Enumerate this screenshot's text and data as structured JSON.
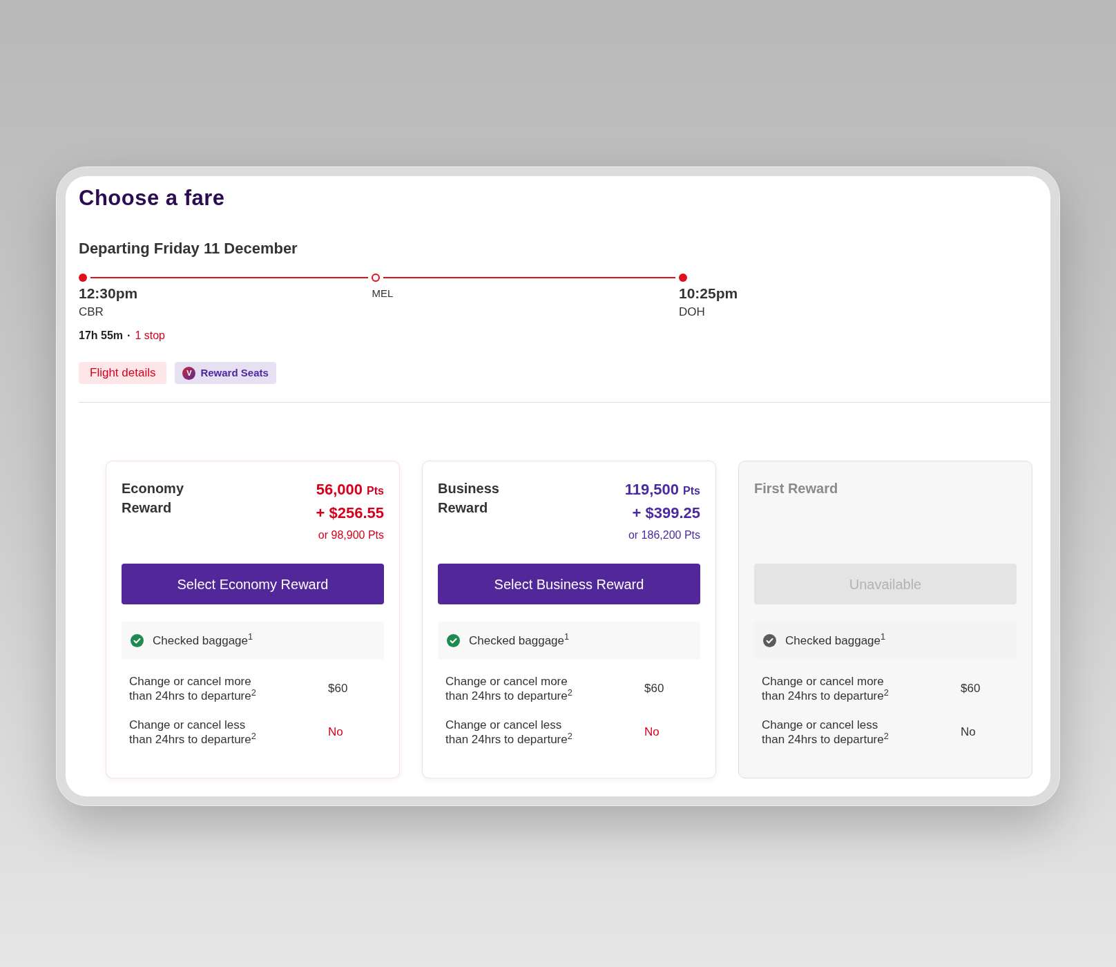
{
  "page": {
    "title": "Choose a fare"
  },
  "journey": {
    "heading": "Departing Friday 11 December",
    "departure": {
      "time": "12:30pm",
      "airport": "CBR"
    },
    "stopovers": [
      {
        "airport": "MEL"
      }
    ],
    "arrival": {
      "time": "10:25pm",
      "airport": "DOH"
    },
    "duration": "17h 55m",
    "separator": "·",
    "stops": "1 stop"
  },
  "actions": [
    {
      "kind": "link",
      "label": "Flight details"
    },
    {
      "kind": "badge",
      "label": "Reward Seats",
      "logo_text": "V"
    }
  ],
  "fares": [
    {
      "name": "Economy Reward",
      "available": true,
      "color": "#d6001c",
      "price": {
        "points": "56,000",
        "points_unit": "Pts",
        "cash": "+ $256.55",
        "alternative": "or 98,900 Pts"
      },
      "button": "Select Economy Reward",
      "features": [
        {
          "kind": "inclusion",
          "label": "Checked baggage$^{1}$",
          "included": true
        },
        {
          "kind": "condition",
          "label": "Change or cancel more than 24hrs to departure$^{2}$",
          "value": "$60",
          "negative": false
        },
        {
          "kind": "condition",
          "label": "Change or cancel less than 24hrs to departure$^{2}$",
          "value": "No",
          "negative": true
        }
      ]
    },
    {
      "name": "Business Reward",
      "available": true,
      "color": "#4b2a9e",
      "price": {
        "points": "119,500",
        "points_unit": "Pts",
        "cash": "+ $399.25",
        "alternative": "or 186,200 Pts"
      },
      "button": "Select Business Reward",
      "features": [
        {
          "kind": "inclusion",
          "label": "Checked baggage$^{1}$",
          "included": true
        },
        {
          "kind": "condition",
          "label": "Change or cancel more than 24hrs to departure$^{2}$",
          "value": "$60",
          "negative": false
        },
        {
          "kind": "condition",
          "label": "Change or cancel less than 24hrs to departure$^{2}$",
          "value": "No",
          "negative": true
        }
      ]
    },
    {
      "name": "First Reward",
      "available": false,
      "button": "Unavailable",
      "features": [
        {
          "kind": "inclusion",
          "label": "Checked baggage$^{1}$",
          "included": true
        },
        {
          "kind": "condition",
          "label": "Change or cancel more than 24hrs to departure$^{2}$",
          "value": "$60",
          "negative": false
        },
        {
          "kind": "condition",
          "label": "Change or cancel less than 24hrs to departure$^{2}$",
          "value": "No",
          "negative": false
        }
      ]
    }
  ]
}
